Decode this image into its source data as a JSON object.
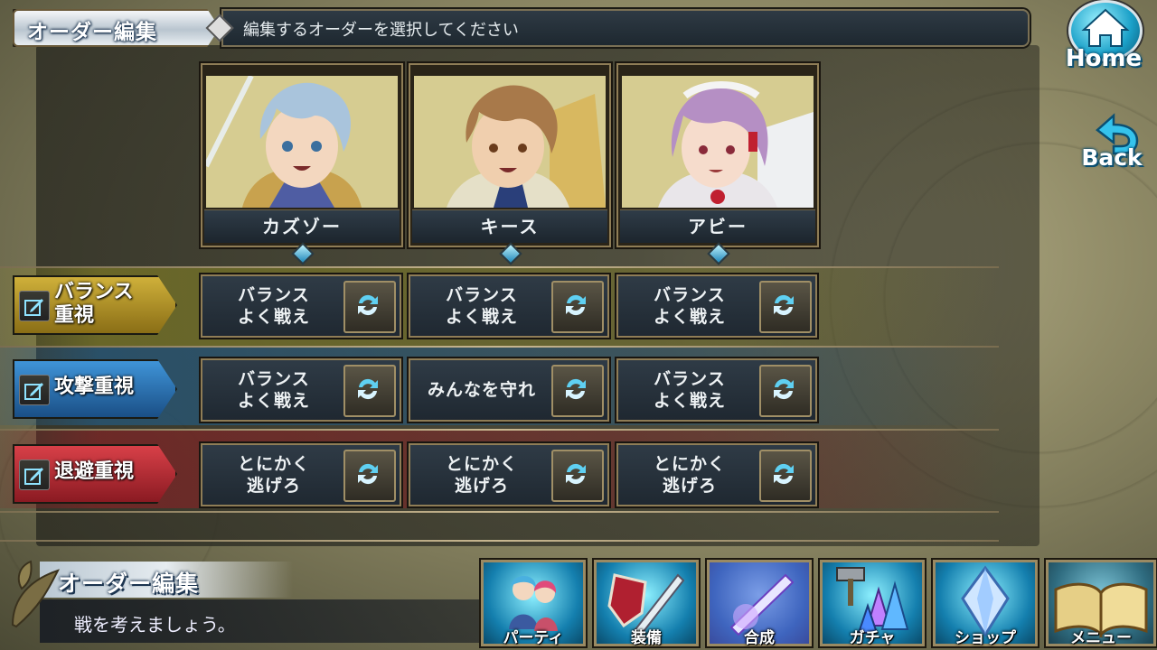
{
  "header": {
    "title": "オーダー編集",
    "instruction": "編集するオーダーを選択してください"
  },
  "nav": {
    "home_label": "Home",
    "back_label": "Back"
  },
  "characters": [
    {
      "name": "カズゾー",
      "hair": "#a9c4dc",
      "outfit": "#c8a24e"
    },
    {
      "name": "キース",
      "hair": "#a8794a",
      "outfit": "#d9d2b0"
    },
    {
      "name": "アビー",
      "hair": "#b58fc4",
      "outfit": "#e9e6ea"
    }
  ],
  "orders": [
    {
      "label": "バランス\n重視",
      "band_color": "#8f8b24",
      "label_color": "#b59a2a",
      "options": [
        "バランス\nよく戦え",
        "バランス\nよく戦え",
        "バランス\nよく戦え"
      ]
    },
    {
      "label": "攻撃重視",
      "band_color": "#1f5f8f",
      "label_color": "#2b7cc0",
      "options": [
        "バランス\nよく戦え",
        "みんなを守れ",
        "バランス\nよく戦え"
      ]
    },
    {
      "label": "退避重視",
      "band_color": "#8f1f24",
      "label_color": "#c43038",
      "options": [
        "とにかく\n逃げろ",
        "とにかく\n逃げろ",
        "とにかく\n逃げろ"
      ]
    }
  ],
  "message": {
    "title": "オーダー編集",
    "body": "戦を考えましょう。"
  },
  "menu": [
    {
      "label": "パーティ",
      "icon": "party-icon"
    },
    {
      "label": "装備",
      "icon": "equipment-icon"
    },
    {
      "label": "合成",
      "icon": "fusion-icon"
    },
    {
      "label": "ガチャ",
      "icon": "gacha-icon"
    },
    {
      "label": "ショップ",
      "icon": "shop-icon"
    },
    {
      "label": "メニュー",
      "icon": "menu-book-icon"
    }
  ],
  "colors": {
    "accent_teal": "#1aa0c8",
    "frame_gold": "#8f7d56",
    "panel_dark": "#1f2831"
  }
}
